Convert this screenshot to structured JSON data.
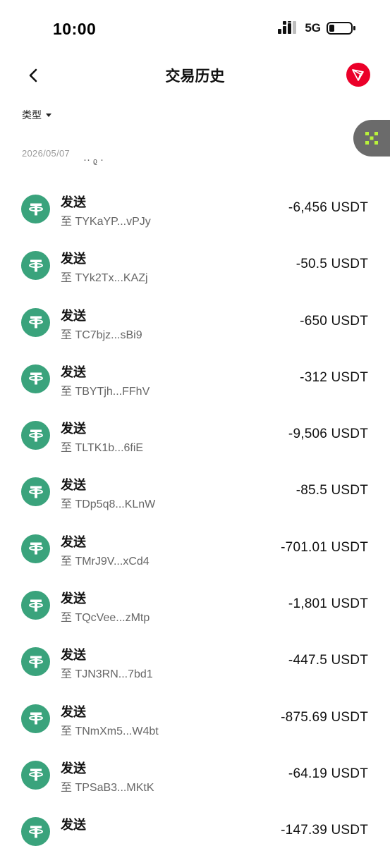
{
  "status_bar": {
    "time": "10:00",
    "network": "5G"
  },
  "header": {
    "title": "交易历史"
  },
  "filter": {
    "label": "类型"
  },
  "date_group": "2026/05/07",
  "colors": {
    "usdt_green": "#3aa37c",
    "tron_red": "#eb0029",
    "float_gray": "#6b6b6b",
    "float_accent": "#b9f23a"
  },
  "icons": {
    "back": "chevron-left-icon",
    "network": "tron-icon",
    "coin": "usdt-tether-icon",
    "float": "grid-x-icon"
  },
  "transactions": [
    {
      "type": "发送",
      "address": "至 TYKaYP...vPJy",
      "amount": "-6,456 USDT"
    },
    {
      "type": "发送",
      "address": "至 TYk2Tx...KAZj",
      "amount": "-50.5 USDT"
    },
    {
      "type": "发送",
      "address": "至 TC7bjz...sBi9",
      "amount": "-650 USDT"
    },
    {
      "type": "发送",
      "address": "至 TBYTjh...FFhV",
      "amount": "-312 USDT"
    },
    {
      "type": "发送",
      "address": "至 TLTK1b...6fiE",
      "amount": "-9,506 USDT"
    },
    {
      "type": "发送",
      "address": "至 TDp5q8...KLnW",
      "amount": "-85.5 USDT"
    },
    {
      "type": "发送",
      "address": "至 TMrJ9V...xCd4",
      "amount": "-701.01 USDT"
    },
    {
      "type": "发送",
      "address": "至 TQcVee...zMtp",
      "amount": "-1,801 USDT"
    },
    {
      "type": "发送",
      "address": "至 TJN3RN...7bd1",
      "amount": "-447.5 USDT"
    },
    {
      "type": "发送",
      "address": "至 TNmXm5...W4bt",
      "amount": "-875.69 USDT"
    },
    {
      "type": "发送",
      "address": "至 TPSaB3...MKtK",
      "amount": "-64.19 USDT"
    },
    {
      "type": "发送",
      "address": "",
      "amount": "-147.39 USDT"
    }
  ]
}
